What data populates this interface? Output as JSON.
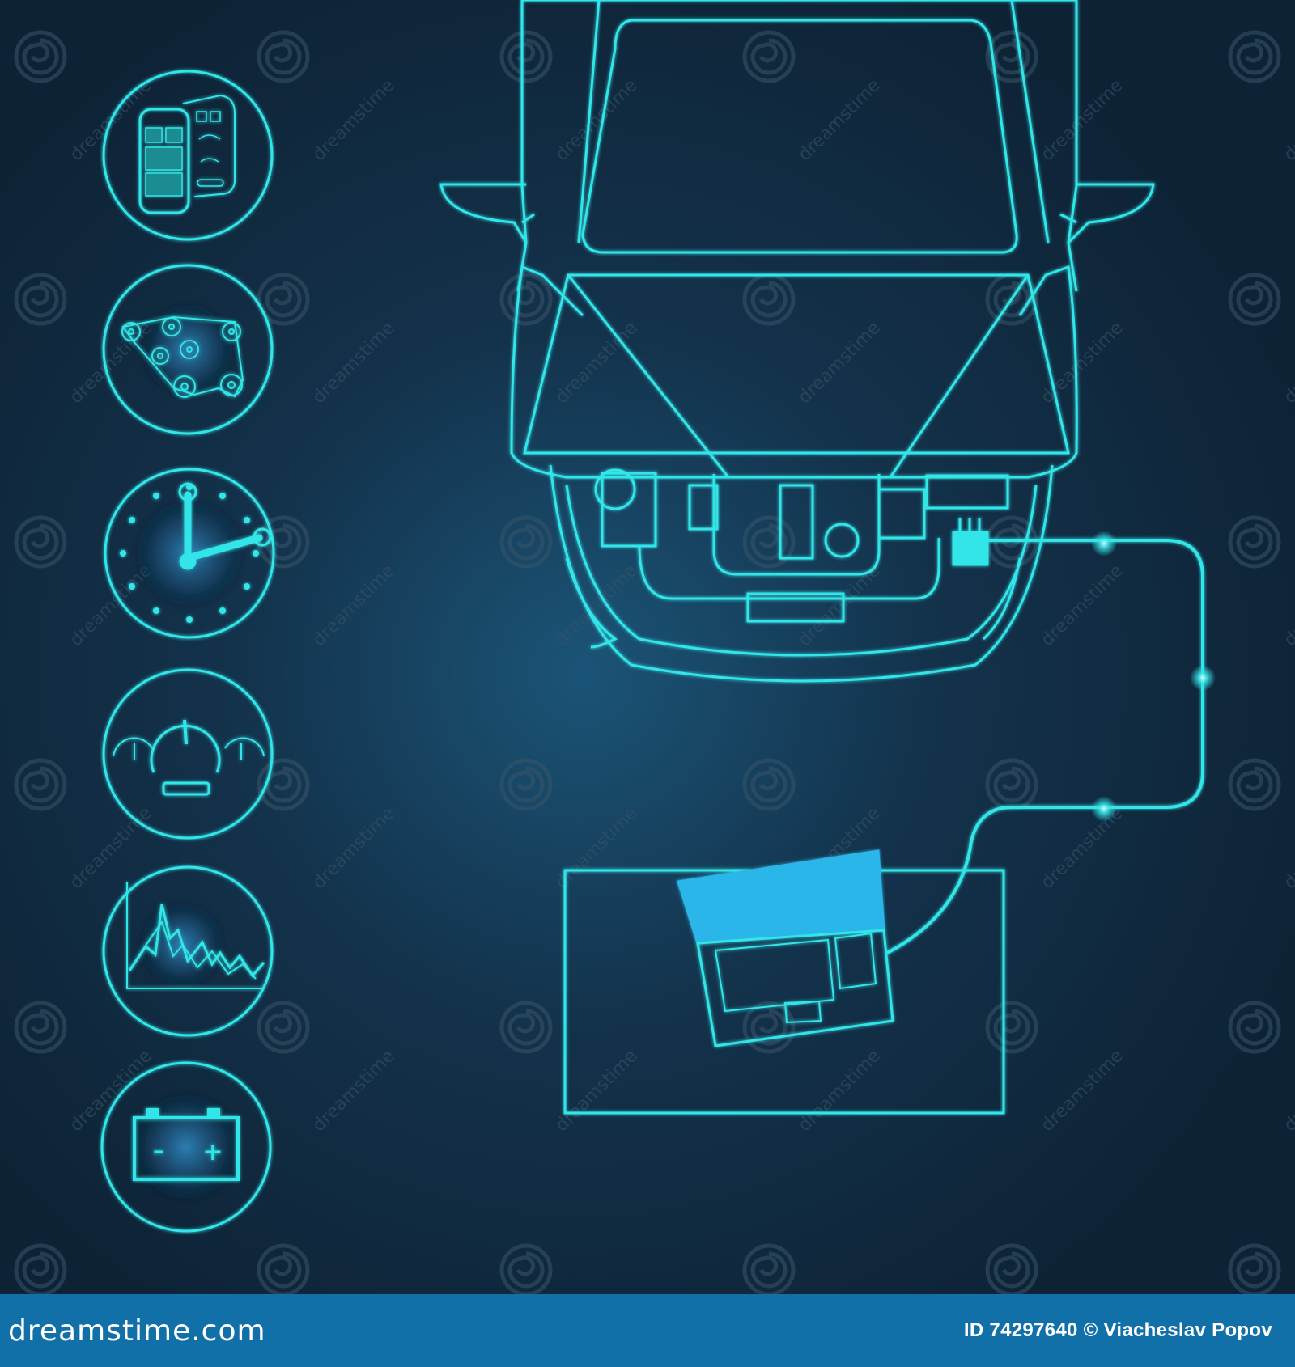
{
  "palette": {
    "background": "#0f2538",
    "line": "#33e5e8",
    "screen": "#2cb6e8",
    "footer": "#1270a8",
    "footer_text": "#ffffff",
    "watermark": "#3a5568"
  },
  "icons": [
    {
      "name": "car-key-remote-icon"
    },
    {
      "name": "engine-belt-pulleys-icon"
    },
    {
      "name": "wrench-clock-icon"
    },
    {
      "name": "dashboard-gauges-icon"
    },
    {
      "name": "diagnostic-graph-icon"
    },
    {
      "name": "battery-icon"
    }
  ],
  "battery": {
    "minus": "–",
    "plus": "+"
  },
  "watermark": {
    "text": "dreamstime"
  },
  "footer": {
    "brand": "dreamstime.com",
    "credit": "ID 74297640 © Viacheslav Popov"
  }
}
